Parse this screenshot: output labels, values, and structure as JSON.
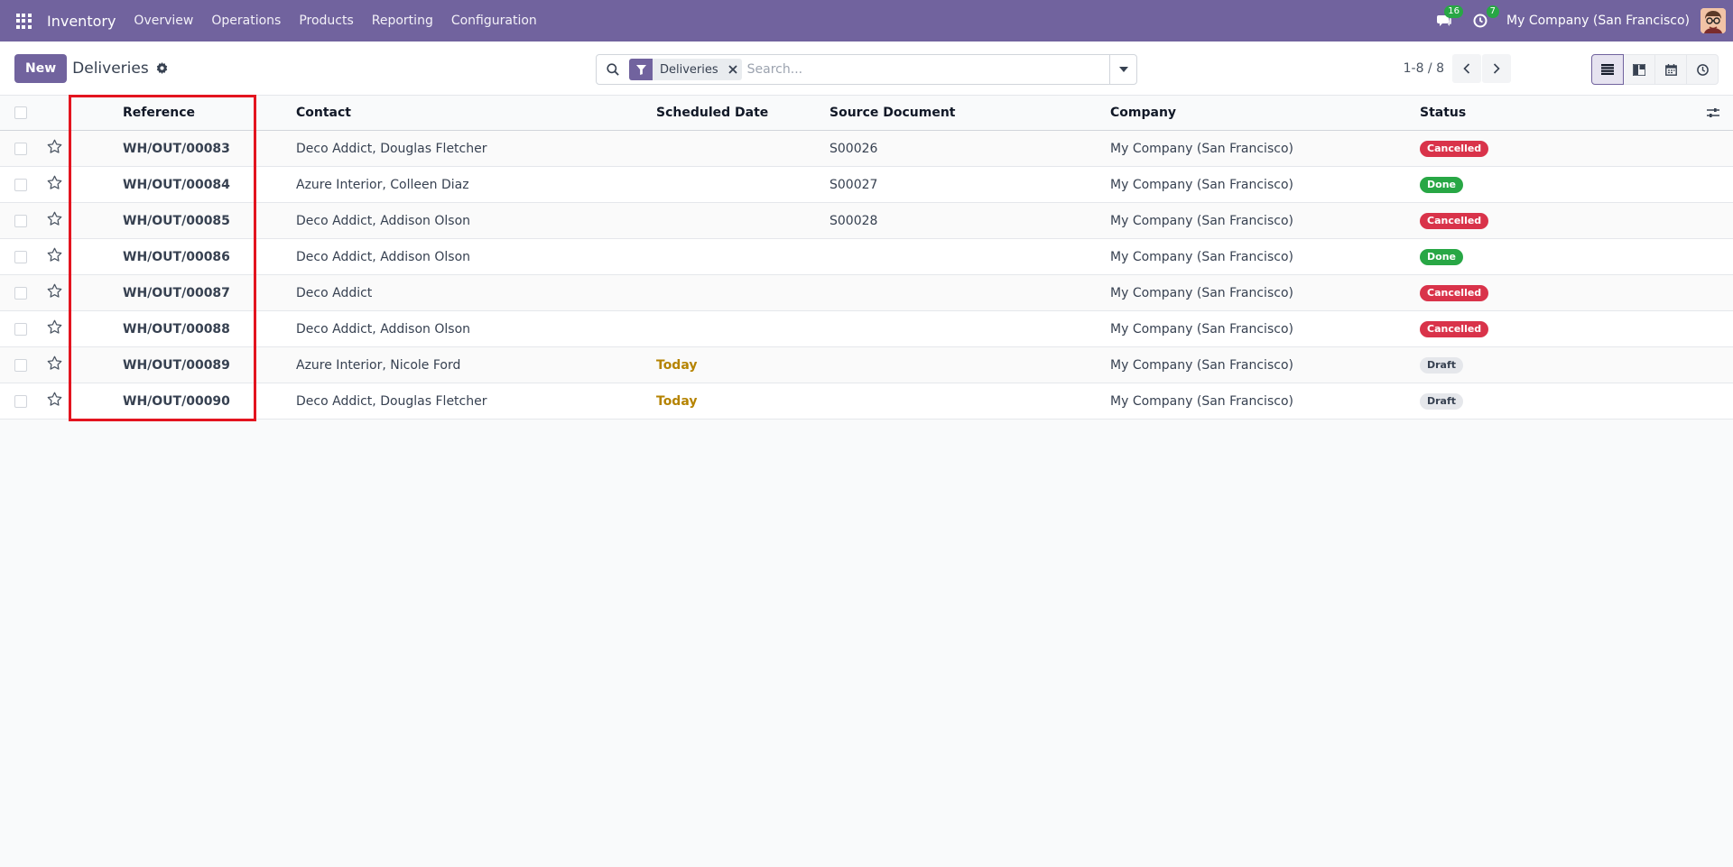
{
  "navbar": {
    "app_name": "Inventory",
    "menu": [
      "Overview",
      "Operations",
      "Products",
      "Reporting",
      "Configuration"
    ],
    "messages_count": "16",
    "activities_count": "7",
    "company": "My Company (San Francisco)",
    "bg_color": "#71639e"
  },
  "control_panel": {
    "new_label": "New",
    "title": "Deliveries",
    "search": {
      "facet_label": "Deliveries",
      "placeholder": "Search..."
    },
    "pager": "1-8 / 8"
  },
  "list": {
    "columns": [
      "Reference",
      "Contact",
      "Scheduled Date",
      "Source Document",
      "Company",
      "Status"
    ],
    "rows": [
      {
        "reference": "WH/OUT/00083",
        "contact": "Deco Addict, Douglas Fletcher",
        "date": "",
        "source": "S00026",
        "company": "My Company (San Francisco)",
        "status": "Cancelled",
        "status_kind": "cancelled"
      },
      {
        "reference": "WH/OUT/00084",
        "contact": "Azure Interior, Colleen Diaz",
        "date": "",
        "source": "S00027",
        "company": "My Company (San Francisco)",
        "status": "Done",
        "status_kind": "done"
      },
      {
        "reference": "WH/OUT/00085",
        "contact": "Deco Addict, Addison Olson",
        "date": "",
        "source": "S00028",
        "company": "My Company (San Francisco)",
        "status": "Cancelled",
        "status_kind": "cancelled"
      },
      {
        "reference": "WH/OUT/00086",
        "contact": "Deco Addict, Addison Olson",
        "date": "",
        "source": "",
        "company": "My Company (San Francisco)",
        "status": "Done",
        "status_kind": "done"
      },
      {
        "reference": "WH/OUT/00087",
        "contact": "Deco Addict",
        "date": "",
        "source": "",
        "company": "My Company (San Francisco)",
        "status": "Cancelled",
        "status_kind": "cancelled"
      },
      {
        "reference": "WH/OUT/00088",
        "contact": "Deco Addict, Addison Olson",
        "date": "",
        "source": "",
        "company": "My Company (San Francisco)",
        "status": "Cancelled",
        "status_kind": "cancelled"
      },
      {
        "reference": "WH/OUT/00089",
        "contact": "Azure Interior, Nicole Ford",
        "date": "Today",
        "source": "",
        "company": "My Company (San Francisco)",
        "status": "Draft",
        "status_kind": "draft"
      },
      {
        "reference": "WH/OUT/00090",
        "contact": "Deco Addict, Douglas Fletcher",
        "date": "Today",
        "source": "",
        "company": "My Company (San Francisco)",
        "status": "Draft",
        "status_kind": "draft"
      }
    ]
  },
  "colors": {
    "cancelled": "#d9334a",
    "done": "#28a745",
    "draft": "#e5e7eb",
    "highlight": "#e3141f"
  }
}
